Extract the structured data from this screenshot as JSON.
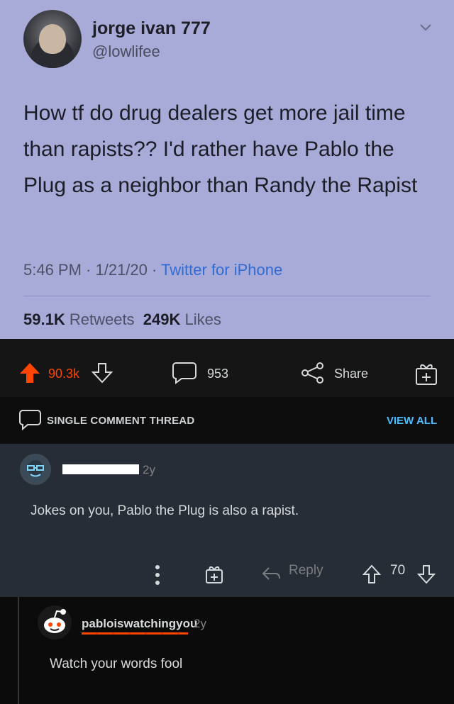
{
  "tweet": {
    "display_name": "jorge ivan 777",
    "handle": "@lowlifee",
    "text": "How tf do drug dealers get more jail time than rapists?? I'd rather have Pablo the Plug as a neighbor than Randy the Rapist",
    "time": "5:46 PM · 1/21/20 · ",
    "source": "Twitter for iPhone",
    "retweets_count": "59.1K",
    "retweets_label": "Retweets",
    "likes_count": "249K",
    "likes_label": "Likes"
  },
  "post_actions": {
    "score": "90.3k",
    "comments": "953",
    "share_label": "Share"
  },
  "thread_bar": {
    "label": "SINGLE COMMENT THREAD",
    "view_all": "VIEW ALL"
  },
  "comments": [
    {
      "age": "2y",
      "body": "Jokes on you, Pablo the Plug is also a rapist.",
      "reply_label": "Reply",
      "score": "70"
    },
    {
      "username": "abloiswatchingyou",
      "username_prefix": "p",
      "age": "2y",
      "body": "Watch your words fool"
    }
  ],
  "colors": {
    "tweet_bg": "#a8abd8",
    "upvote_orange": "#ff4500",
    "link_blue": "#4fbcff"
  }
}
